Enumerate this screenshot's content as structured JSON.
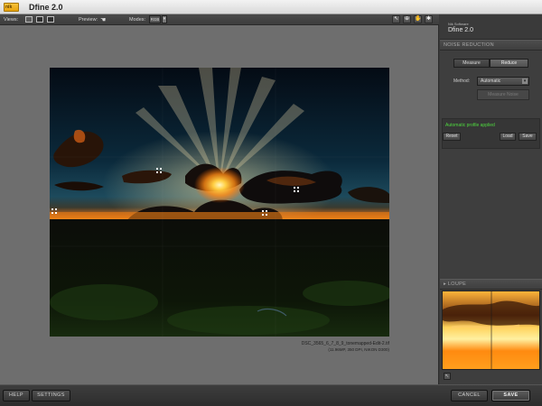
{
  "window": {
    "title": "Dfine 2.0",
    "logo_text": "nik"
  },
  "toolbar": {
    "views_label": "Views:",
    "preview_label": "Preview:",
    "modes_label": "Modes:",
    "mode_value": "RGB",
    "preview_icon": "hand-pointer-icon",
    "tools": [
      "zoom-out-icon",
      "zoom-in-icon",
      "pan-icon",
      "settings-icon"
    ]
  },
  "image": {
    "filename": "DSC_3565_6_7_8_9_tonemapped-Edit-2.tif",
    "info": "(11.96MP, 350 DPI, NIKON D300)",
    "markers": 4
  },
  "panel": {
    "brand_small": "Nik Software",
    "brand_name": "Dfine 2.0",
    "noise_reduction_title": "NOISE REDUCTION",
    "tab_measure": "Measure",
    "tab_reduce": "Reduce",
    "method_label": "Method:",
    "method_value": "Automatic",
    "measure_noise_button": "Measure Noise",
    "status_text": "Automatic profile applied",
    "reset_label": "Reset",
    "load_label": "Load",
    "save_label": "Save",
    "loupe_title": "LOUPE"
  },
  "bottom": {
    "help": "HELP",
    "settings": "SETTINGS",
    "cancel": "CANCEL",
    "save": "SAVE"
  },
  "colors": {
    "status_green": "#4fd93f",
    "canvas_gray": "#6e6e6e",
    "panel_dark": "#3e3e3e"
  }
}
